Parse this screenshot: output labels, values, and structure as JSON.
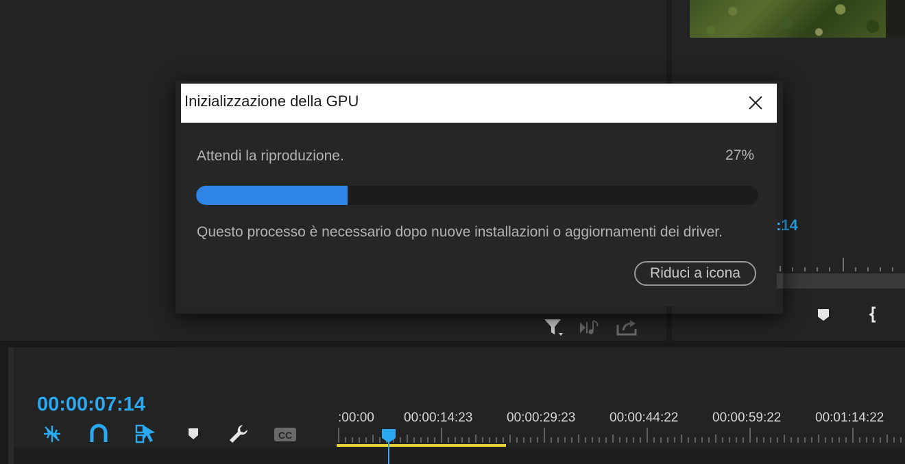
{
  "dialog": {
    "title": "Inizializzazione della GPU",
    "status": "Attendi la riproduzione.",
    "percent_label": "27%",
    "progress_fraction": 0.27,
    "info": "Questo processo è necessario dopo nuove installazioni o aggiornamenti dei driver.",
    "minimize_label": "Riduci a icona",
    "close_icon": "close-icon"
  },
  "program_monitor": {
    "timecode_partial": ":14"
  },
  "timeline": {
    "timecode": "00:00:07:14",
    "ruler_labels": [
      ":00:00",
      "00:00:14:23",
      "00:00:29:23",
      "00:00:44:22",
      "00:00:59:22",
      "00:01:14:22"
    ],
    "tools": [
      "insert-sequence-icon",
      "snap-magnet-icon",
      "linked-selection-icon",
      "add-marker-icon",
      "settings-wrench-icon",
      "captions-icon"
    ]
  },
  "colors": {
    "accent": "#2aa8f0",
    "progress": "#2f86e6",
    "inout_bar": "#e8d33a",
    "background": "#232323"
  }
}
